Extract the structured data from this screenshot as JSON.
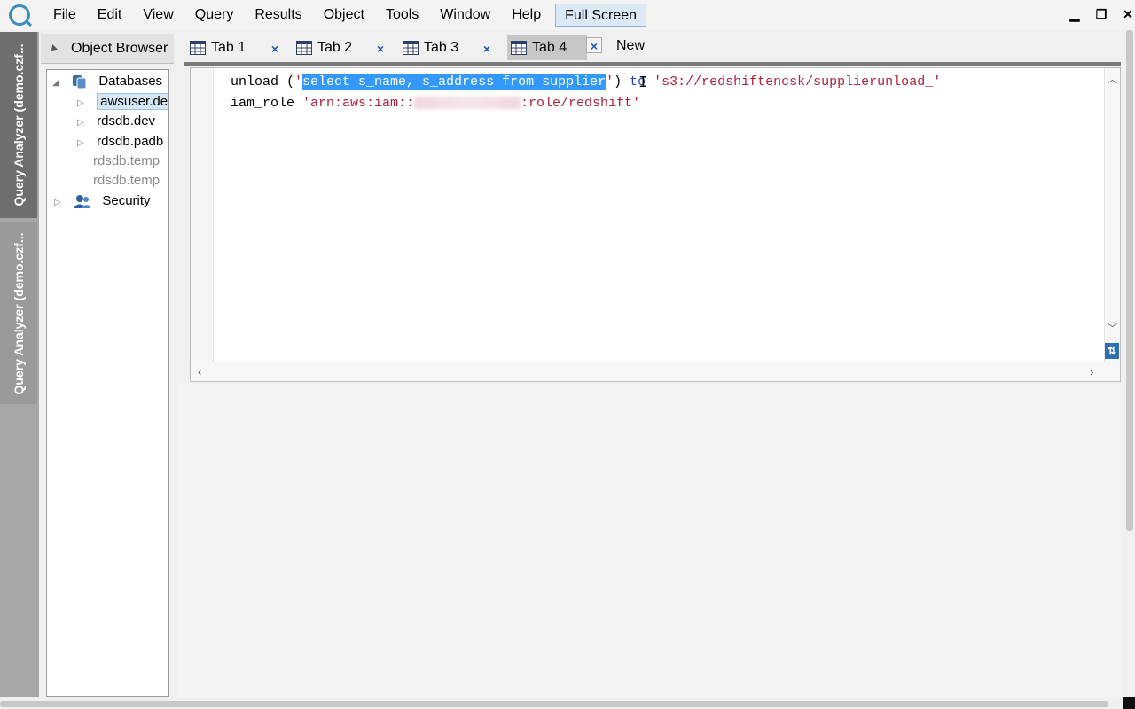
{
  "menubar": {
    "items": [
      "File",
      "Edit",
      "View",
      "Query",
      "Results",
      "Object",
      "Tools",
      "Window",
      "Help"
    ],
    "fullscreen_label": "Full Screen"
  },
  "side_tabs": [
    "Query Analyzer (demo.czf...",
    "Query Analyzer (demo.czf..."
  ],
  "object_browser": {
    "title": "Object Browser",
    "tree": {
      "databases": "Databases",
      "items": [
        "awsuser.de",
        "rdsdb.dev",
        "rdsdb.padb",
        "rdsdb.temp",
        "rdsdb.temp"
      ],
      "security": "Security"
    }
  },
  "tabs": {
    "labels": [
      "Tab 1",
      "Tab 2",
      "Tab 3",
      "Tab 4"
    ],
    "close": "×",
    "new_label": "New"
  },
  "editor": {
    "line1_kw": "unload (",
    "line1_q": "'",
    "line1_selected": "select s_name, s_address from supplier",
    "line1_after_sel": "'",
    "line1_close": ")",
    "line1_to": " to ",
    "line1_path": "'s3://redshiftencsk/supplierunload_'",
    "line2_kw": "iam_role ",
    "line2_pre": "'arn:aws:iam::",
    "line2_post": ":role/redshift'"
  },
  "colors": {
    "selection": "#3399ff",
    "string": "#b2223b",
    "keyword_blue": "#1f3fbf"
  }
}
